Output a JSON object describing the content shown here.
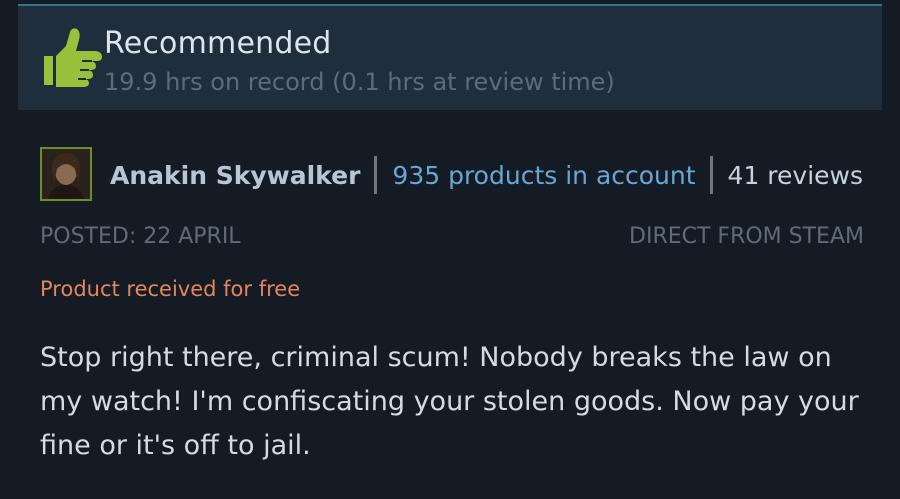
{
  "header": {
    "title": "Recommended",
    "hours": "19.9 hrs on record (0.1 hrs at review time)",
    "icon": "thumbs-up-icon"
  },
  "author": {
    "name": "Anakin Skywalker",
    "products": "935 products in account",
    "reviews": "41 reviews",
    "avatar_border_color": "#6b8e27"
  },
  "meta": {
    "posted": "POSTED: 22 APRIL",
    "source": "DIRECT FROM STEAM",
    "free_notice": "Product received for free"
  },
  "review": {
    "text": "Stop right there, criminal scum! Nobody breaks the law on my watch! I'm confiscating your stolen goods. Now pay your fine or it's off to jail."
  },
  "colors": {
    "background": "#141b25",
    "header_bg": "#1f2d3d",
    "link": "#67a7d4",
    "free_notice": "#e3865a",
    "thumb": "#9ac13c"
  }
}
